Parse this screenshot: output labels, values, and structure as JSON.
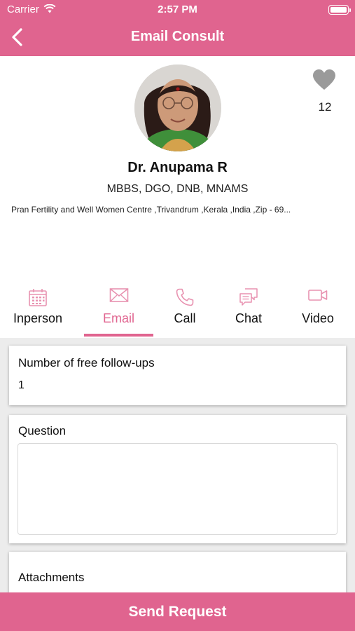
{
  "status_bar": {
    "carrier": "Carrier",
    "time": "2:57 PM"
  },
  "header": {
    "title": "Email Consult"
  },
  "doctor": {
    "favorites_count": "12",
    "name": "Dr. Anupama R",
    "qualifications": "MBBS, DGO, DNB, MNAMS",
    "address": "Pran Fertility and Well Women Centre ,Trivandrum ,Kerala ,India ,Zip - 69..."
  },
  "tabs": [
    {
      "label": "Inperson",
      "icon": "calendar-icon"
    },
    {
      "label": "Email",
      "icon": "envelope-icon",
      "active": true
    },
    {
      "label": "Call",
      "icon": "phone-icon"
    },
    {
      "label": "Chat",
      "icon": "chat-icon"
    },
    {
      "label": "Video",
      "icon": "video-camera-icon"
    }
  ],
  "form": {
    "followups_label": "Number of free follow-ups",
    "followups_value": "1",
    "question_label": "Question",
    "question_value": "",
    "attachments_label": "Attachments"
  },
  "actions": {
    "send_label": "Send Request"
  },
  "colors": {
    "accent": "#e0648f",
    "tab_icon": "#e892b0",
    "heart": "#9a9a9a"
  }
}
